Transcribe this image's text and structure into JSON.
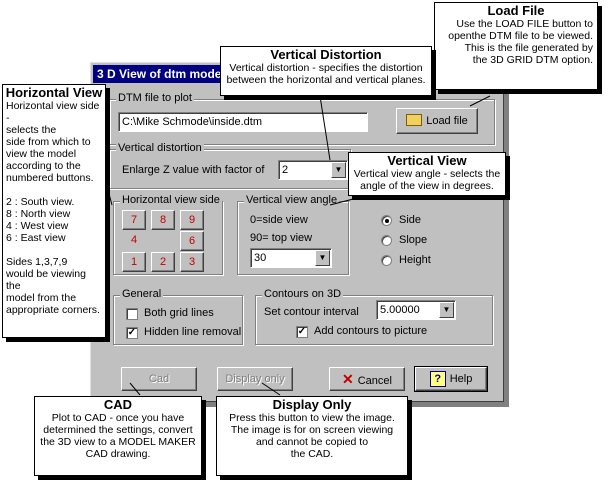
{
  "dialog": {
    "title": "3 D View of dtm mode",
    "dtm": {
      "label": "DTM file to plot",
      "value": "C:\\Mike Schmode\\inside.dtm",
      "load_button": "Load file"
    },
    "vertical_distortion": {
      "group_label": "Vertical distortion",
      "label": "Enlarge Z value  with factor of",
      "value": "2"
    },
    "horizontal_view_side": {
      "group_label": "Horizontal view side",
      "buttons": [
        "7",
        "8",
        "9",
        "4",
        "6",
        "1",
        "2",
        "3"
      ]
    },
    "vertical_view_angle": {
      "group_label": "Vertical view angle",
      "hint1": "0=side view",
      "hint2": "90= top view",
      "value": "30"
    },
    "view_type": {
      "options": [
        "Side",
        "Slope",
        "Height"
      ],
      "selected": "Side"
    },
    "general": {
      "group_label": "General",
      "grid_lines": "Both grid lines",
      "hidden_line": "Hidden line removal"
    },
    "contours": {
      "group_label": "Contours on 3D",
      "interval_label": "Set contour interval",
      "interval_value": "5.00000",
      "add_label": "Add contours to picture"
    },
    "buttons": {
      "cad": "Cad",
      "display_only": "Display only",
      "cancel": "Cancel",
      "help": "Help"
    }
  },
  "callouts": {
    "load_file": {
      "title": "Load File",
      "text": "Use the LOAD FILE button to\nopenthe DTM file to be viewed.\nThis is the file generated by\nthe 3D GRID DTM option."
    },
    "vertical_distortion": {
      "title": "Vertical Distortion",
      "text": "Vertical distortion - specifies the distortion\nbetween the horizontal and vertical planes."
    },
    "horizontal_view": {
      "title": "Horizontal View",
      "text": "Horizontal view side -\nselects the\nside from which to\nview the model\naccording to the\nnumbered buttons.\n\n2 : South view.\n8 : North view\n4 : West view\n6 : East view\n\nSides 1,3,7,9\nwould be viewing the\nmodel from the\nappropriate corners."
    },
    "vertical_view": {
      "title": "Vertical View",
      "text": "Vertical view angle - selects the\nangle of the view in degrees."
    },
    "cad": {
      "title": "CAD",
      "text": "Plot to CAD - once you have\ndetermined the settings, convert\nthe 3D view to a MODEL MAKER\nCAD drawing."
    },
    "display_only": {
      "title": "Display Only",
      "text": "Press this button to view the image.\nThe image is for on screen viewing\nand cannot be copied to\nthe CAD."
    }
  }
}
